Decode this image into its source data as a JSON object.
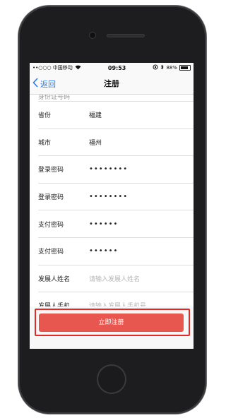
{
  "status_bar": {
    "carrier": "••○○○ 中国移动",
    "time": "09:53",
    "battery": "88%"
  },
  "nav": {
    "back_label": "返回",
    "title": "注册"
  },
  "form": {
    "rows": [
      {
        "label": "身份证号码",
        "value": "",
        "partial": true
      },
      {
        "label": "省份",
        "value": "福建"
      },
      {
        "label": "城市",
        "value": "福州"
      },
      {
        "label": "登录密码",
        "value": "••••••••"
      },
      {
        "label": "登录密码",
        "value": "••••••••"
      },
      {
        "label": "支付密码",
        "value": "••••••"
      },
      {
        "label": "支付密码",
        "value": "••••••"
      },
      {
        "label": "发展人姓名",
        "placeholder": "请输入发展人姓名"
      },
      {
        "label": "发展人手机",
        "placeholder": "请输入发展人手机号"
      }
    ]
  },
  "submit_label": "立即注册",
  "colors": {
    "accent_blue": "#2a7bf5",
    "button_red": "#e7574f",
    "highlight_red": "#e02a2a"
  }
}
